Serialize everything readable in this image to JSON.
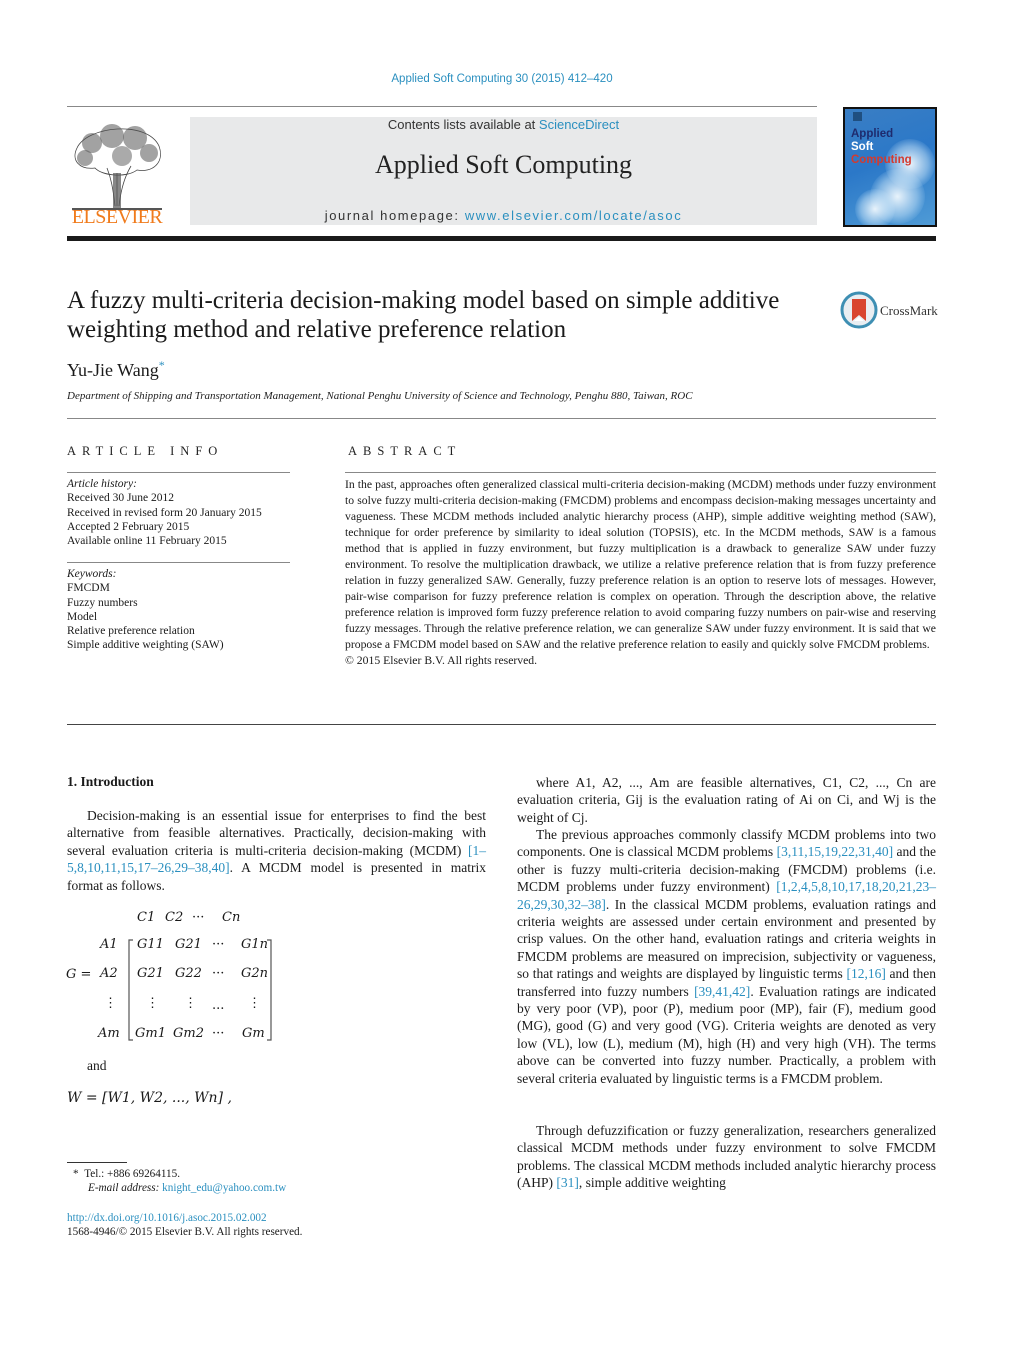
{
  "header": {
    "journal_ref": "Applied Soft Computing 30 (2015) 412–420",
    "contents_prefix": "Contents lists available at ",
    "contents_link": "ScienceDirect",
    "journal_title": "Applied Soft Computing",
    "homepage_prefix": "journal homepage: ",
    "homepage_link": "www.elsevier.com/locate/asoc",
    "publisher_logo": "ELSEVIER",
    "cover": {
      "line1": "Applied",
      "line2": "Soft",
      "line3": "Computing"
    }
  },
  "article": {
    "title": "A fuzzy multi-criteria decision-making model based on simple additive weighting method and relative preference relation",
    "crossmark_label": "CrossMark",
    "author": "Yu-Jie Wang",
    "author_mark": "*",
    "affiliation": "Department of Shipping and Transportation Management, National Penghu University of Science and Technology, Penghu 880, Taiwan, ROC"
  },
  "article_info": {
    "heading": "ARTICLE INFO",
    "history_label": "Article history:",
    "history": [
      "Received 30 June 2012",
      "Received in revised form 20 January 2015",
      "Accepted 2 February 2015",
      "Available online 11 February 2015"
    ],
    "keywords_label": "Keywords:",
    "keywords": [
      "FMCDM",
      "Fuzzy numbers",
      "Model",
      "Relative preference relation",
      "Simple additive weighting (SAW)"
    ]
  },
  "abstract": {
    "heading": "ABSTRACT",
    "text": "In the past, approaches often generalized classical multi-criteria decision-making (MCDM) methods under fuzzy environment to solve fuzzy multi-criteria decision-making (FMCDM) problems and encompass decision-making messages uncertainty and vagueness. These MCDM methods included analytic hierarchy process (AHP), simple additive weighting method (SAW), technique for order preference by similarity to ideal solution (TOPSIS), etc. In the MCDM methods, SAW is a famous method that is applied in fuzzy environment, but fuzzy multiplication is a drawback to generalize SAW under fuzzy environment. To resolve the multiplication drawback, we utilize a relative preference relation that is from fuzzy preference relation in fuzzy generalized SAW. Generally, fuzzy preference relation is an option to reserve lots of messages. However, pair-wise comparison for fuzzy preference relation is complex on operation. Through the description above, the relative preference relation is improved form fuzzy preference relation to avoid comparing fuzzy numbers on pair-wise and reserving fuzzy messages. Through the relative preference relation, we can generalize SAW under fuzzy environment. It is said that we propose a FMCDM model based on SAW and the relative preference relation to easily and quickly solve FMCDM problems.",
    "copyright": "© 2015 Elsevier B.V. All rights reserved."
  },
  "intro": {
    "heading": "1.  Introduction",
    "p1_text": "Decision-making is an essential issue for enterprises to find the best alternative from feasible alternatives. Practically, decision-making with several evaluation criteria is multi-criteria decision-making (MCDM) ",
    "p1_cite": "[1–5,8,10,11,15,17–26,29–38,40]",
    "p1_tail": ". A MCDM model is presented in matrix format as follows.",
    "matrix": {
      "lhs": "G =",
      "col_headers": [
        "C1",
        "C2",
        "···",
        "Cn"
      ],
      "row_labels": [
        "A1",
        "A2",
        "⋮",
        "Am"
      ],
      "rows": [
        [
          "G11",
          "G21",
          "···",
          "G1n"
        ],
        [
          "G21",
          "G22",
          "···",
          "G2n"
        ],
        [
          "⋮",
          "⋮",
          "...",
          "⋮"
        ],
        [
          "Gm1",
          "Gm2",
          "···",
          "Gm"
        ]
      ]
    },
    "and_word": "and",
    "w_vector": "W = [W1, W2, ..., Wn] ,"
  },
  "right_col": {
    "where_text": "where A1, A2, ..., Am are feasible alternatives, C1, C2, ..., Cn are evaluation criteria, Gij is the evaluation rating of Ai on Ci, and Wj is the weight of Cj.",
    "p2_a": "The previous approaches commonly classify MCDM problems into two components. One is classical MCDM problems ",
    "p2_cite1": "[3,11,15,19,22,31,40]",
    "p2_b": " and the other is fuzzy multi-criteria decision-making (FMCDM) problems (i.e. MCDM problems under fuzzy environment) ",
    "p2_cite2": "[1,2,4,5,8,10,17,18,20,21,23–26,29,30,32–38]",
    "p2_c": ". In the classical MCDM problems, evaluation ratings and criteria weights are assessed under certain environment and presented by crisp values. On the other hand, evaluation ratings and criteria weights in FMCDM problems are measured on imprecision, subjectivity or vagueness, so that ratings and weights are displayed by linguistic terms ",
    "p2_cite3": "[12,16]",
    "p2_d": " and then transferred into fuzzy numbers ",
    "p2_cite4": "[39,41,42]",
    "p2_e": ". Evaluation ratings are indicated by very poor (VP), poor (P), medium poor (MP), fair (F), medium good (MG), good (G) and very good (VG). Criteria weights are denoted as very low (VL), low (L), medium (M), high (H) and very high (VH). The terms above can be converted into fuzzy number. Practically, a problem with several criteria evaluated by linguistic terms is a FMCDM problem.",
    "p3_a": "Through defuzzification or fuzzy generalization, researchers generalized classical MCDM methods under fuzzy environment to solve FMCDM problems. The classical MCDM methods included analytic hierarchy process (AHP) ",
    "p3_cite": "[31]",
    "p3_b": ", simple additive weighting"
  },
  "footnotes": {
    "mark": "*",
    "tel": "Tel.: +886 69264115.",
    "email_label": "E-mail address: ",
    "email": "knight_edu@yahoo.com.tw",
    "doi": "http://dx.doi.org/10.1016/j.asoc.2015.02.002",
    "issn": "1568-4946/© 2015 Elsevier B.V. All rights reserved."
  }
}
